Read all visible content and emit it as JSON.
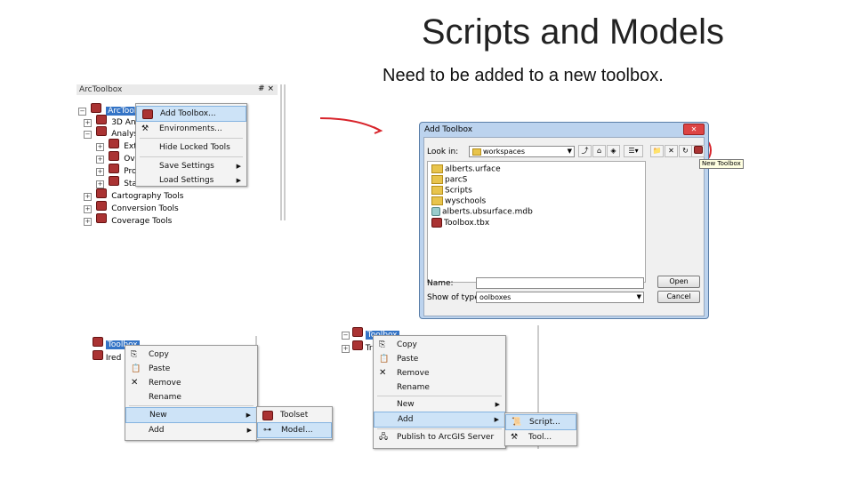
{
  "slide": {
    "title": "Scripts and Models",
    "subtitle": "Need to be added to a new toolbox."
  },
  "arctoolbox_panel": {
    "title": "ArcToolbox",
    "header_controls": "# ×",
    "root_item": "ArcToolbox",
    "tree_items": [
      "3D Anal",
      "Analysis",
      "Extra",
      "Ove",
      "Prox",
      "Stati",
      "Cartography Tools",
      "Conversion Tools",
      "Coverage Tools"
    ],
    "context_menu": {
      "items": [
        "Add Toolbox...",
        "Environments...",
        "Hide Locked Tools",
        "Save Settings",
        "Load Settings"
      ]
    }
  },
  "add_toolbox_dialog": {
    "title": "Add Toolbox",
    "look_in_label": "Look in:",
    "look_in_value": "workspaces",
    "files": [
      "alberts.urface",
      "parcS",
      "Scripts",
      "wyschools",
      "alberts.ubsurface.mdb",
      "Toolbox.tbx"
    ],
    "new_toolbox_tooltip": "New Toolbox",
    "name_label": "Name:",
    "name_value": "",
    "type_label": "Show of type:",
    "type_value": "oolboxes",
    "open_button": "Open",
    "cancel_button": "Cancel"
  },
  "bottom_left": {
    "tree_items": [
      "Toolbox",
      "Ired"
    ],
    "context_menu": [
      "Copy",
      "Paste",
      "Remove",
      "Rename",
      "New",
      "Add"
    ],
    "submenu": [
      "Toolset",
      "Model..."
    ]
  },
  "bottom_right": {
    "tree_items": [
      "Toolbox",
      "Tr"
    ],
    "context_menu": [
      "Copy",
      "Paste",
      "Remove",
      "Rename",
      "New",
      "Add",
      "Publish to ArcGIS Server"
    ],
    "submenu": [
      "Script...",
      "Tool..."
    ]
  },
  "colors": {
    "highlight": "#cde3f7",
    "annotation_red": "#d8232a"
  }
}
